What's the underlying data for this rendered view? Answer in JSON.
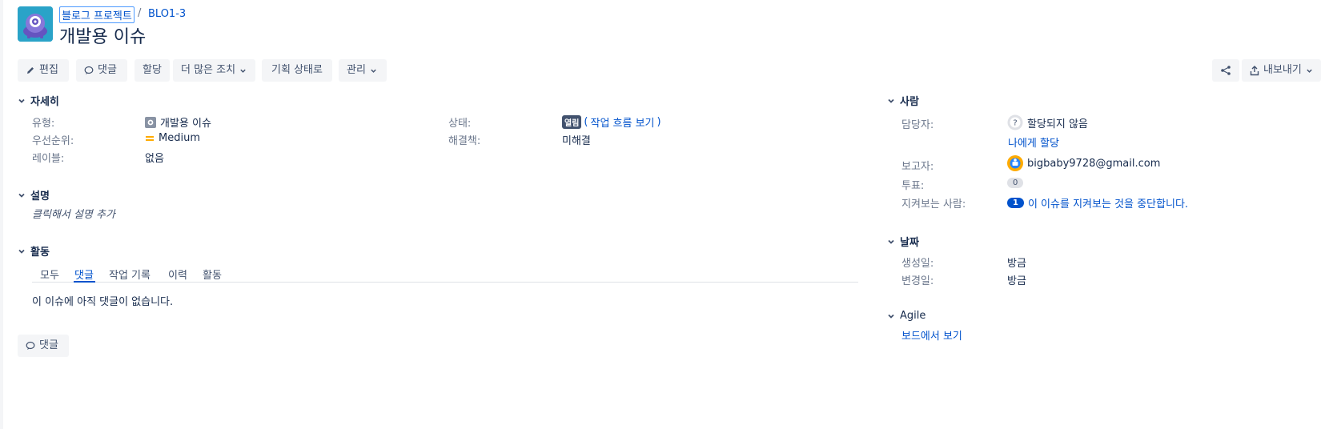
{
  "breadcrumb": {
    "project": "블로그 프로젝트",
    "separator": "/",
    "issue_key": "BLO1-3"
  },
  "title": "개발용 이슈",
  "toolbar": {
    "edit": "편집",
    "comment": "댓글",
    "assign": "할당",
    "more": "더 많은 조치",
    "planning_state": "기획 상태로",
    "manage": "관리",
    "export": "내보내기"
  },
  "details": {
    "heading": "자세히",
    "type_label": "유형:",
    "type_value": "개발용 이슈",
    "priority_label": "우선순위:",
    "priority_value": "Medium",
    "labels_label": "레이블:",
    "labels_value": "없음",
    "status_label": "상태:",
    "status_lozenge": "열림",
    "status_open_paren": "(",
    "workflow_link": "작업 흐름 보기",
    "status_close_paren": ")",
    "resolution_label": "해결책:",
    "resolution_value": "미해결"
  },
  "description": {
    "heading": "설명",
    "placeholder": "클릭해서 설명 추가"
  },
  "activity": {
    "heading": "활동",
    "tabs": [
      "모두",
      "댓글",
      "작업 기록",
      "이력",
      "활동"
    ],
    "active_tab": "댓글",
    "empty_message": "이 이슈에 아직 댓글이 없습니다.",
    "comment_button": "댓글"
  },
  "people": {
    "heading": "사람",
    "assignee_label": "담당자:",
    "assignee_value": "할당되지 않음",
    "assign_to_me": "나에게 할당",
    "reporter_label": "보고자:",
    "reporter_value": "bigbaby9728@gmail.com",
    "votes_label": "투표:",
    "votes_count": "0",
    "watchers_label": "지켜보는 사람:",
    "watchers_count": "1",
    "watch_stop_link": "이 이슈를 지켜보는 것을 중단합니다."
  },
  "dates": {
    "heading": "날짜",
    "created_label": "생성일:",
    "created_value": "방금",
    "updated_label": "변경일:",
    "updated_value": "방금"
  },
  "agile": {
    "heading": "Agile",
    "view_board": "보드에서 보기"
  },
  "colors": {
    "link": "#0052cc",
    "text": "#172b4d",
    "muted": "#6b778c",
    "button_bg": "#f4f5f7",
    "priority": "#ffab00",
    "avatar_bg": "#2aa3c8"
  },
  "icons": {
    "project_avatar": "project-avatar-icon",
    "edit": "pencil-icon",
    "comment": "comment-icon",
    "share": "share-icon",
    "export": "export-icon",
    "issue_type": "issue-type-icon",
    "priority": "priority-medium-icon",
    "unassigned": "unassigned-avatar-icon",
    "reporter": "reporter-avatar-icon"
  }
}
